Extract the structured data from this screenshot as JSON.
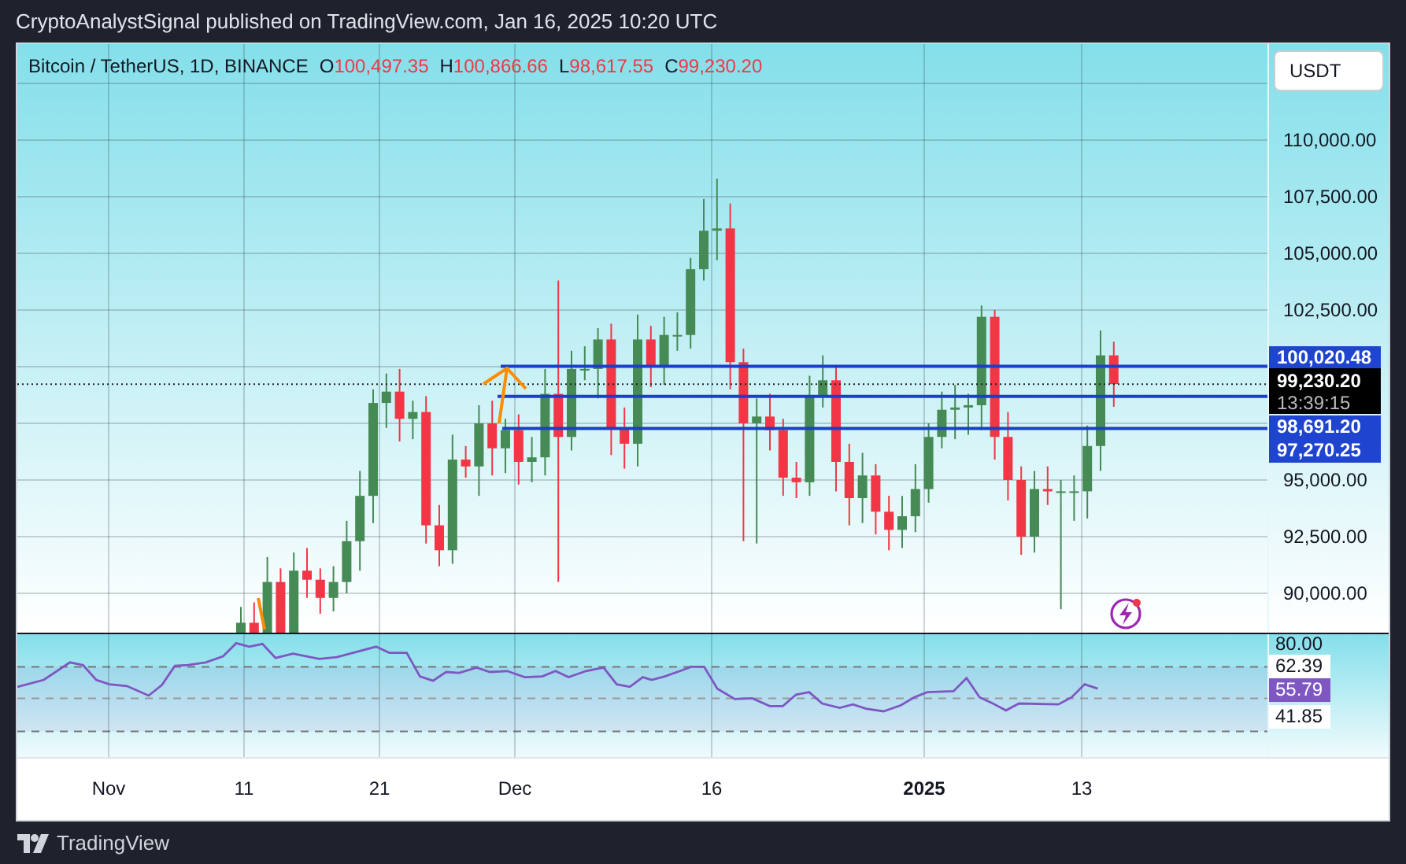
{
  "header": {
    "text": "CryptoAnalystSignal published on TradingView.com, Jan 16, 2025 10:20 UTC"
  },
  "legend": {
    "symbol": "Bitcoin / TetherUS, 1D, BINANCE",
    "ohlc": [
      {
        "label": "O",
        "value": "100,497.35"
      },
      {
        "label": "H",
        "value": "100,866.66"
      },
      {
        "label": "L",
        "value": "98,617.55"
      },
      {
        "label": "C",
        "value": "99,230.20"
      }
    ]
  },
  "currency_button": {
    "label": "USDT"
  },
  "price_axis": {
    "ticks": [
      "110,000.00",
      "107,500.00",
      "105,000.00",
      "102,500.00",
      "95,000.00",
      "92,500.00",
      "90,000.00"
    ],
    "tags": [
      {
        "kind": "level",
        "text": "100,020.48"
      },
      {
        "kind": "last",
        "text": "99,230.20",
        "countdown": "13:39:15"
      },
      {
        "kind": "level",
        "text": "98,691.20"
      },
      {
        "kind": "level",
        "text": "97,270.25"
      }
    ]
  },
  "rsi_axis": {
    "labels": [
      {
        "kind": "scale",
        "text": "80.00"
      },
      {
        "kind": "band",
        "text": "62.39"
      },
      {
        "kind": "value",
        "text": "55.79"
      },
      {
        "kind": "band",
        "text": "41.85"
      }
    ]
  },
  "time_axis": {
    "labels": [
      {
        "kind": "month",
        "text": "Nov"
      },
      {
        "kind": "day",
        "text": "11"
      },
      {
        "kind": "day",
        "text": "21"
      },
      {
        "kind": "month",
        "text": "Dec"
      },
      {
        "kind": "day",
        "text": "16"
      },
      {
        "kind": "year",
        "text": "2025"
      },
      {
        "kind": "day",
        "text": "13"
      }
    ]
  },
  "footer": {
    "brand": "TradingView"
  }
}
